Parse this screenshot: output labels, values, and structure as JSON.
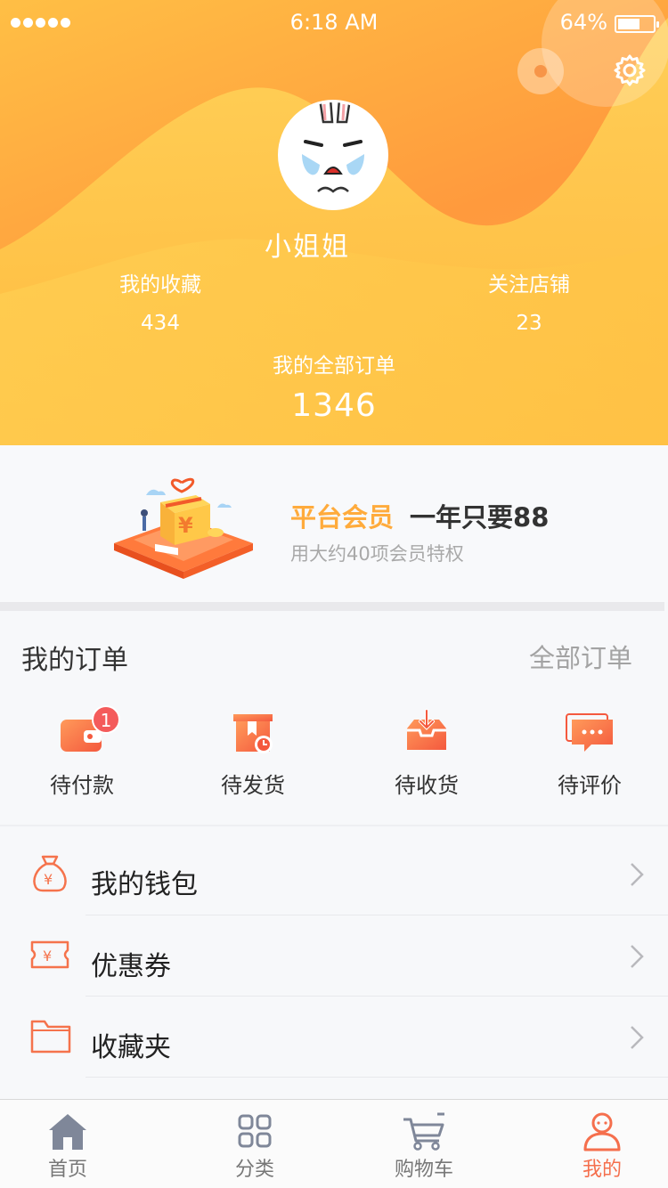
{
  "status_bar": {
    "time": "6:18 AM",
    "battery_percent": "64%",
    "battery_level": 0.64
  },
  "profile": {
    "username": "小姐姐",
    "favorites_label": "我的收藏",
    "favorites_count": "434",
    "followed_shops_label": "关注店铺",
    "followed_shops_count": "23",
    "all_orders_label": "我的全部订单",
    "all_orders_count": "1346"
  },
  "member": {
    "title_accent": "平台会员",
    "title_price": "一年只要88",
    "subtitle": "用大约40项会员特权",
    "gift_glyph": "¥"
  },
  "orders": {
    "title": "我的订单",
    "all_link": "全部订单",
    "items": [
      {
        "label": "待付款",
        "icon": "wallet-icon",
        "badge": "1"
      },
      {
        "label": "待发货",
        "icon": "box-clock-icon"
      },
      {
        "label": "待收货",
        "icon": "inbox-download-icon"
      },
      {
        "label": "待评价",
        "icon": "chat-bubble-icon"
      }
    ]
  },
  "menu": [
    {
      "label": "我的钱包",
      "icon": "money-bag-icon",
      "glyph": "¥"
    },
    {
      "label": "优惠券",
      "icon": "coupon-icon",
      "glyph": "¥"
    },
    {
      "label": "收藏夹",
      "icon": "folder-icon"
    }
  ],
  "tabbar": [
    {
      "label": "首页",
      "icon": "home-icon",
      "active": false
    },
    {
      "label": "分类",
      "icon": "grid-icon",
      "active": false
    },
    {
      "label": "购物车",
      "icon": "cart-icon",
      "active": false
    },
    {
      "label": "我的",
      "icon": "profile-icon",
      "active": true
    }
  ],
  "colors": {
    "accent": "#ffab3c",
    "icon_orange": "#f5734c",
    "active_tab": "#f56f4d",
    "badge": "#f45b5b",
    "inactive_tab": "#7f8799"
  }
}
